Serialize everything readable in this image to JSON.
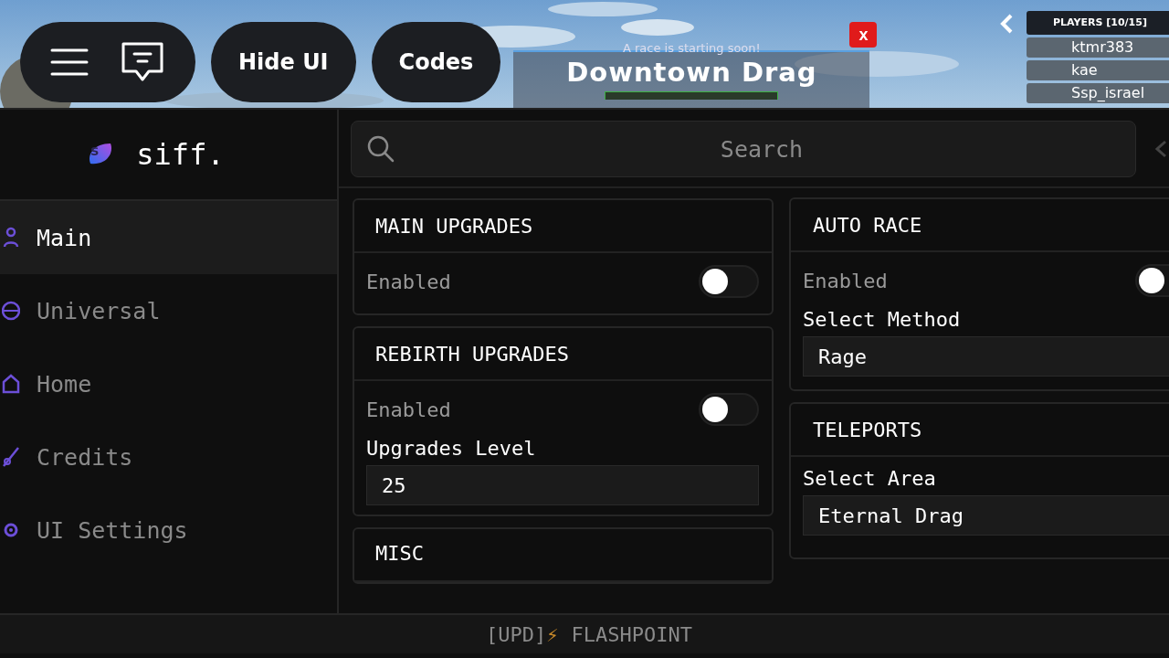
{
  "hud": {
    "icon_buttons": [
      {
        "kind": "menu"
      },
      {
        "kind": "chat"
      }
    ],
    "buttons": [
      "Hide UI",
      "Codes"
    ]
  },
  "race_banner": {
    "subtitle": "A race is starting soon!",
    "title": "Downtown Drag",
    "close": "x"
  },
  "players": {
    "title": "PLAYERS [10/15]",
    "names": [
      "ktmr383",
      "kae",
      "Ssp_israel"
    ]
  },
  "app": {
    "logo_mark": "S",
    "logo": "siff.",
    "sidebar": [
      {
        "label": "Main",
        "selected": true
      },
      {
        "label": "Universal",
        "selected": false
      },
      {
        "label": "Home",
        "selected": false
      },
      {
        "label": "Credits",
        "selected": false
      },
      {
        "label": "UI Settings",
        "selected": false
      }
    ],
    "search": {
      "placeholder": "Search"
    },
    "columns": [
      [
        {
          "title": "MAIN UPGRADES",
          "items": [
            {
              "kind": "toggle",
              "label": "Enabled",
              "on": false
            }
          ]
        },
        {
          "title": "REBIRTH UPGRADES",
          "items": [
            {
              "kind": "toggle",
              "label": "Enabled",
              "on": false
            },
            {
              "kind": "input",
              "label": "Upgrades Level",
              "value": "25"
            }
          ]
        },
        {
          "title": "MISC"
        }
      ],
      [
        {
          "title": "AUTO RACE",
          "items": [
            {
              "kind": "toggle",
              "label": "Enabled",
              "on": false
            },
            {
              "kind": "dropdown",
              "label": "Select Method",
              "value": "Rage"
            }
          ]
        },
        {
          "title": "TELEPORTS",
          "items": [
            {
              "kind": "dropdown",
              "label": "Select Area",
              "value": "Eternal Drag"
            }
          ]
        }
      ]
    ],
    "footer": {
      "prefix": "[UPD]",
      "emoji": "⚡",
      "title": "FLASHPOINT"
    }
  }
}
